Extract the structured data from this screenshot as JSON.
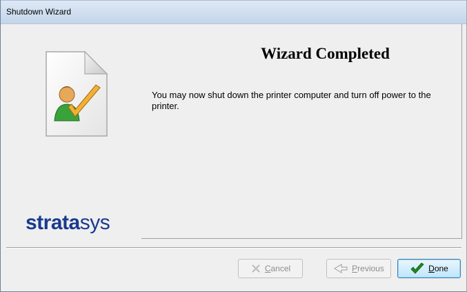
{
  "window": {
    "title": "Shutdown Wizard"
  },
  "content": {
    "heading": "Wizard Completed",
    "message": "You may now shut down the printer computer and turn off power to the printer."
  },
  "brand": {
    "part1": "strata",
    "part2": "sys"
  },
  "buttons": {
    "cancel": {
      "mnemonic": "C",
      "rest": "ancel",
      "icon": "x-icon",
      "enabled": false
    },
    "previous": {
      "mnemonic": "P",
      "rest": "revious",
      "icon": "back-arrow-icon",
      "enabled": false
    },
    "done": {
      "mnemonic": "D",
      "rest": "one",
      "icon": "checkmark-icon",
      "enabled": true
    }
  },
  "icons": {
    "wizard_image": "document-user-checkmark-icon"
  },
  "colors": {
    "brand": "#1a3a8f",
    "checkmark": "#1e8a1e",
    "accent": "#e8a33a"
  }
}
